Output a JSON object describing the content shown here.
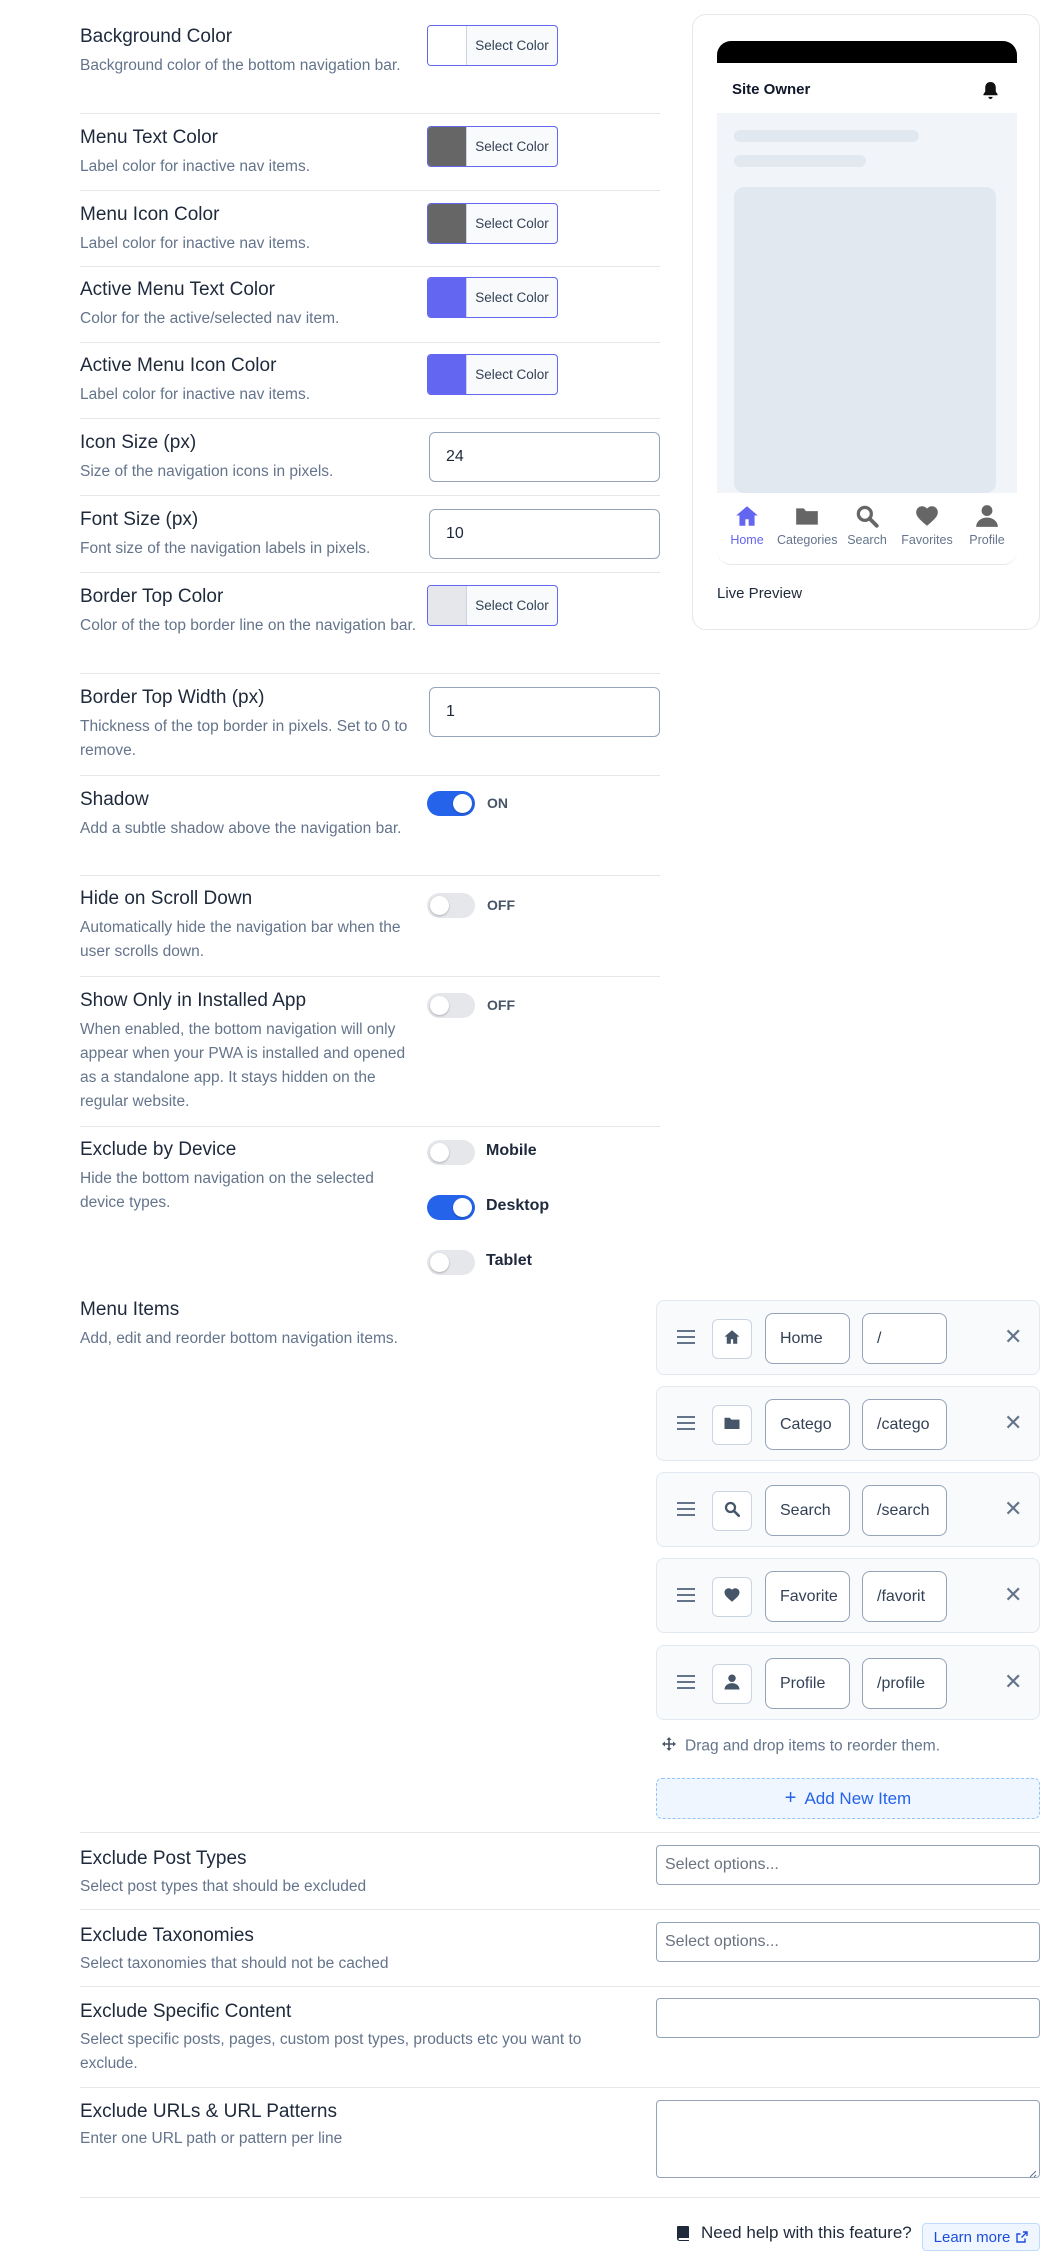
{
  "settings": [
    {
      "label": "Background Color",
      "desc": "Background color of the bottom navigation bar.",
      "button": "Select Color",
      "color": "#ffffff"
    },
    {
      "label": "Menu Text Color",
      "desc": "Label color for inactive nav items.",
      "button": "Select Color",
      "color": "#666666"
    },
    {
      "label": "Menu Icon Color",
      "desc": "Label color for inactive nav items.",
      "button": "Select Color",
      "color": "#666666"
    },
    {
      "label": "Active Menu Text Color",
      "desc": "Color for the active/selected nav item.",
      "button": "Select Color",
      "color": "#6366f1"
    },
    {
      "label": "Active Menu Icon Color",
      "desc": "Label color for inactive nav items.",
      "button": "Select Color",
      "color": "#6366f1"
    },
    {
      "label": "Icon Size (px)",
      "desc": "Size of the navigation icons in pixels.",
      "value": "24"
    },
    {
      "label": "Font Size (px)",
      "desc": "Font size of the navigation labels in pixels.",
      "value": "10"
    },
    {
      "label": "Border Top Color",
      "desc": "Color of the top border line on the navigation bar.",
      "button": "Select Color",
      "color": "#e5e7eb"
    },
    {
      "label": "Border Top Width (px)",
      "desc": "Thickness of the top border in pixels. Set to 0 to remove.",
      "value": "1"
    },
    {
      "label": "Shadow",
      "desc": "Add a subtle shadow above the navigation bar.",
      "state": "ON"
    },
    {
      "label": "Hide on Scroll Down",
      "desc": "Automatically hide the navigation bar when the user scrolls down.",
      "state": "OFF"
    },
    {
      "label": "Show Only in Installed App",
      "desc": "When enabled, the bottom navigation will only appear when your PWA is installed and opened as a standalone app. It stays hidden on the regular website.",
      "state": "OFF"
    }
  ],
  "exclude_device": {
    "label": "Exclude by Device",
    "desc": "Hide the bottom navigation on the selected device types.",
    "options": [
      {
        "label": "Mobile",
        "on": false
      },
      {
        "label": "Desktop",
        "on": true
      },
      {
        "label": "Tablet",
        "on": false
      }
    ]
  },
  "preview": {
    "site_title": "Site Owner",
    "caption": "Live Preview",
    "nav": [
      {
        "label": "Home",
        "icon": "home-icon",
        "active": true
      },
      {
        "label": "Categories",
        "icon": "folder-icon",
        "active": false
      },
      {
        "label": "Search",
        "icon": "search-icon",
        "active": false
      },
      {
        "label": "Favorites",
        "icon": "heart-icon",
        "active": false
      },
      {
        "label": "Profile",
        "icon": "user-icon",
        "active": false
      }
    ]
  },
  "menu_items": {
    "label": "Menu Items",
    "desc": "Add, edit and reorder bottom navigation items.",
    "items": [
      {
        "icon": "home-icon",
        "label": "Home",
        "url": "/"
      },
      {
        "icon": "folder-icon",
        "label": "Catego",
        "url": "/catego"
      },
      {
        "icon": "search-icon",
        "label": "Search",
        "url": "/search"
      },
      {
        "icon": "heart-icon",
        "label": "Favorite",
        "url": "/favorit"
      },
      {
        "icon": "user-icon",
        "label": "Profile",
        "url": "/profile"
      }
    ],
    "close": "✕",
    "hint": "Drag and drop items to reorder them.",
    "add_label": "Add New Item"
  },
  "exclusions": [
    {
      "label": "Exclude Post Types",
      "desc": "Select post types that should be excluded",
      "placeholder": "Select options..."
    },
    {
      "label": "Exclude Taxonomies",
      "desc": "Select taxonomies that should not be cached",
      "placeholder": "Select options..."
    },
    {
      "label": "Exclude Specific Content",
      "desc": "Select specific posts, pages, custom post types, products etc you want to exclude.",
      "placeholder": ""
    },
    {
      "label": "Exclude URLs & URL Patterns",
      "desc": "Enter one URL path or pattern per line",
      "placeholder": ""
    }
  ],
  "footer": {
    "help": "Need help with this feature?",
    "learn": "Learn more"
  },
  "colors": {
    "accent": "#2563eb",
    "active": "#6366f1"
  }
}
